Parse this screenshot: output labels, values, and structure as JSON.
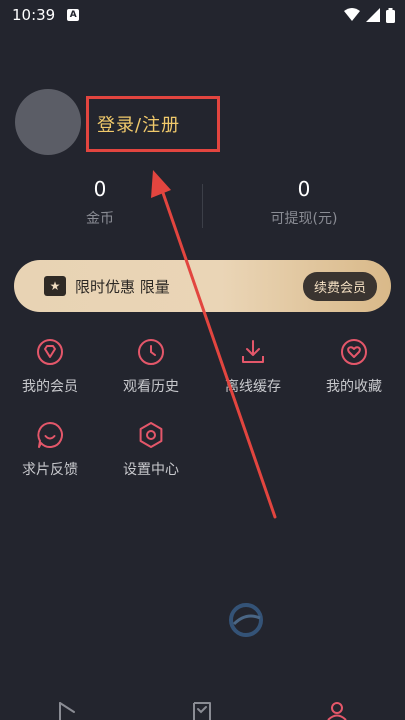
{
  "status_bar": {
    "time": "10:39",
    "sim_label": "A"
  },
  "profile": {
    "login_text": "登录/注册"
  },
  "stats": [
    {
      "value": "0",
      "label": "金币"
    },
    {
      "value": "0",
      "label": "可提现(元)"
    }
  ],
  "promo": {
    "text": "限时优惠 限量",
    "button_label": "续费会员"
  },
  "menu": [
    {
      "label": "我的会员",
      "icon": "diamond-icon"
    },
    {
      "label": "观看历史",
      "icon": "clock-icon"
    },
    {
      "label": "离线缓存",
      "icon": "download-icon"
    },
    {
      "label": "我的收藏",
      "icon": "heart-icon"
    },
    {
      "label": "求片反馈",
      "icon": "chat-icon"
    },
    {
      "label": "设置中心",
      "icon": "settings-icon"
    }
  ],
  "tab_bar": [
    "play-icon",
    "checklist-icon",
    "profile-icon"
  ],
  "colors": {
    "background": "#23252e",
    "accent": "#e4576a",
    "gold_text": "#f0c96b",
    "annotation_red": "#e2453f"
  }
}
